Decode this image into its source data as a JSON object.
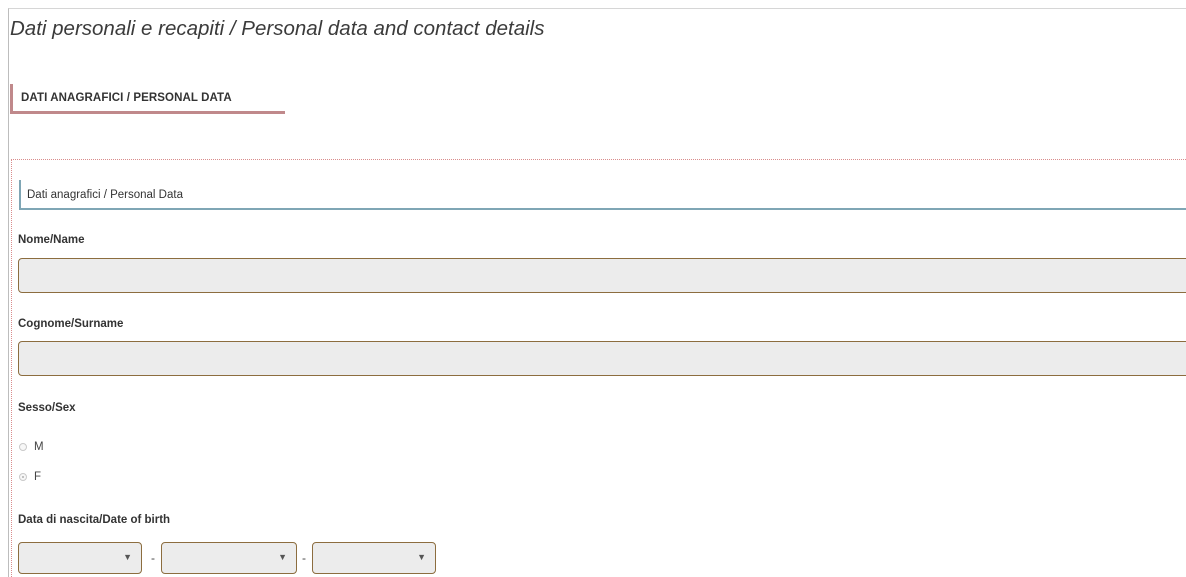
{
  "page": {
    "title": "Dati personali e recapiti / Personal data and contact details"
  },
  "section": {
    "tab_label": "DATI ANAGRAFICI / PERSONAL DATA"
  },
  "panel": {
    "header_label": "Dati anagrafici / Personal Data"
  },
  "fields": {
    "name": {
      "label": "Nome/Name",
      "value": "",
      "placeholder": ""
    },
    "surname": {
      "label": "Cognome/Surname",
      "value": "",
      "placeholder": ""
    },
    "sex": {
      "label": "Sesso/Sex",
      "options": [
        {
          "label": "M",
          "checked": false
        },
        {
          "label": "F",
          "checked": true
        }
      ]
    },
    "birth_date": {
      "label": "Data di nascita/Date of birth",
      "separator": "-",
      "day": "",
      "month": "",
      "year": ""
    }
  },
  "icons": {
    "dropdown": "chevron-down-icon"
  },
  "colors": {
    "section_accent": "#c0898b",
    "panel_accent": "#7fa6b5",
    "input_border": "#8c6d3f",
    "input_background": "#ececec",
    "dotted_border": "#d98c8c"
  }
}
